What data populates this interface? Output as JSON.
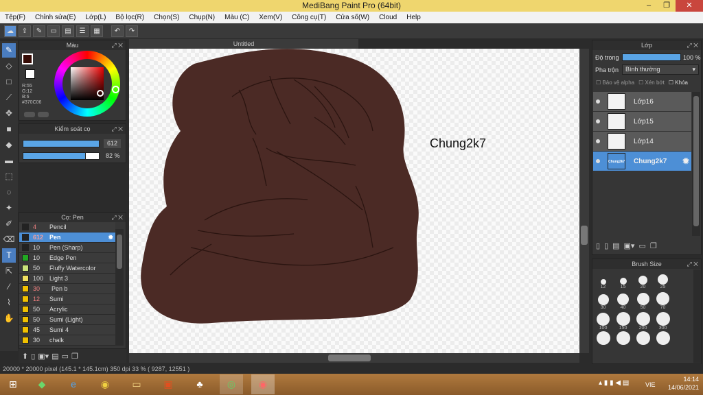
{
  "window": {
    "title": "MediBang Paint Pro (64bit)",
    "minimize": "‒",
    "restore": "❐",
    "close": "✕"
  },
  "menu": [
    "Tệp(F)",
    "Chỉnh sửa(E)",
    "Lớp(L)",
    "Bộ lọc(R)",
    "Chọn(S)",
    "Chụp(N)",
    "Màu (C)",
    "Xem(V)",
    "Công cụ(T)",
    "Cửa số(W)",
    "Cloud",
    "Help"
  ],
  "color_panel": {
    "title": "Màu",
    "r": "R:55",
    "g": "G:12",
    "b": "B:6",
    "hex": "#370C06",
    "primary_color": "#370c06"
  },
  "brush_control": {
    "title": "Kiểm soát cọ",
    "size_value": "612",
    "opacity_value": "82",
    "opacity_unit": "%",
    "size_fraction": 1.0,
    "opacity_fraction": 0.82
  },
  "pen_panel": {
    "title": "Cọ: Pen",
    "items": [
      {
        "size": "4",
        "name": "Pencil",
        "color": "#222222"
      },
      {
        "size": "612",
        "name": "Pen",
        "color": "#222222"
      },
      {
        "size": "10",
        "name": "Pen (Sharp)",
        "color": "#222222"
      },
      {
        "size": "10",
        "name": "Edge Pen",
        "color": "#22a822"
      },
      {
        "size": "50",
        "name": "Fluffy Watercolor",
        "color": "#c9e27a"
      },
      {
        "size": "100",
        "name": "Light 3",
        "color": "#f0e060"
      },
      {
        "size": "30",
        "name": "Pen b",
        "color": "#f0c000"
      },
      {
        "size": "12",
        "name": "Sumi",
        "color": "#f0c000"
      },
      {
        "size": "50",
        "name": "Acrylic",
        "color": "#f0c000"
      },
      {
        "size": "50",
        "name": "Sumi (Light)",
        "color": "#f0c000"
      },
      {
        "size": "45",
        "name": "Sumi 4",
        "color": "#f0c000"
      },
      {
        "size": "30",
        "name": "chalk",
        "color": "#f0c000"
      }
    ]
  },
  "document": {
    "tab": "Untitled",
    "canvas_text": "Chung2k7",
    "fill_color": "#4b2a25"
  },
  "layer_panel": {
    "title": "Lớp",
    "opacity_label": "Độ trong",
    "opacity_value": "100 %",
    "opacity_fraction": 1.0,
    "blend_label": "Pha trộn",
    "blend_value": "Bình thường",
    "protect_alpha": "Bảo vệ alpha",
    "clipping": "Xén bớt",
    "lock": "Khóa",
    "layers": [
      {
        "name": "Lớp16"
      },
      {
        "name": "Lớp15"
      },
      {
        "name": "Lớp14"
      },
      {
        "name": "Chung2k7",
        "thumb_text": "Chung2k7"
      }
    ]
  },
  "brush_size_panel": {
    "title": "Brush Size",
    "sizes": [
      "12",
      "15",
      "20",
      "25",
      "30",
      "40",
      "50",
      "70",
      "100",
      "150",
      "200",
      "300"
    ]
  },
  "status": {
    "text": "20000 * 20000 pixel   (145.1 * 145.1cm)   350 dpi   33 %   ( 9287, 12551 )"
  },
  "taskbar": {
    "lang": "VIE",
    "time": "14:14",
    "date": "14/06/2021"
  }
}
